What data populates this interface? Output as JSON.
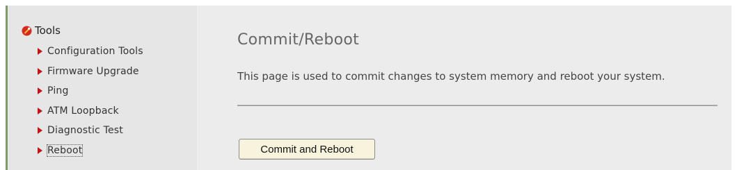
{
  "sidebar": {
    "section_title": "Tools",
    "section_icon": "tools-icon",
    "items": [
      {
        "label": "Configuration Tools",
        "icon": "arrow-right-icon"
      },
      {
        "label": "Firmware Upgrade",
        "icon": "arrow-right-icon"
      },
      {
        "label": "Ping",
        "icon": "arrow-right-icon"
      },
      {
        "label": "ATM Loopback",
        "icon": "arrow-right-icon"
      },
      {
        "label": "Diagnostic Test",
        "icon": "arrow-right-icon"
      },
      {
        "label": "Reboot",
        "icon": "arrow-right-icon",
        "selected": true
      }
    ]
  },
  "main": {
    "title": "Commit/Reboot",
    "description": "This page is used to commit changes to system memory and reboot your system.",
    "button_label": "Commit and Reboot"
  },
  "colors": {
    "accent_red": "#c0161a",
    "sidebar_border": "#7d9a6a",
    "button_bg": "#f7f3dc"
  }
}
